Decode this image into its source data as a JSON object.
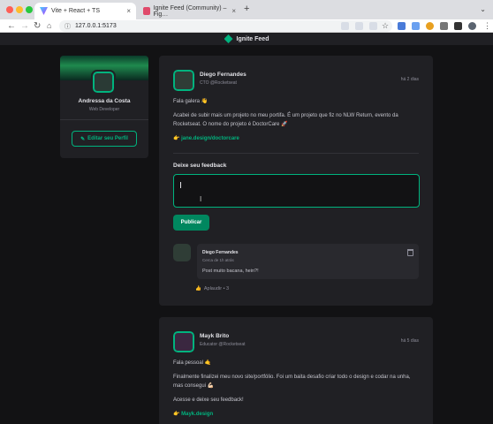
{
  "browser": {
    "tabs": [
      {
        "title": "Vite + React + TS",
        "active": true
      },
      {
        "title": "Ignite Feed (Community) – Fig…",
        "active": false
      }
    ],
    "url": "127.0.0.1:5173",
    "new_tab_icon": "plus-icon"
  },
  "app": {
    "title": "Ignite Feed"
  },
  "profile": {
    "name": "Andressa da Costa",
    "role": "Web Developer",
    "edit_label": "Editar seu Perfil"
  },
  "posts": [
    {
      "author": "Diego Fernandes",
      "role": "CTO @Rocketseat",
      "time": "há 2 dias",
      "greeting": "Fala galera 👋",
      "body": "Acabei de subir mais um projeto no meu portifa. É um projeto que fiz no NLW Return, evento da Rocketseat. O nome do projeto é DoctorCare 🚀",
      "link": "👉 jane.design/doctorcare",
      "feedback_label": "Deixe seu feedback",
      "publish_label": "Publicar",
      "comment": {
        "author": "Diego Fernandes",
        "time": "Cerca de 1h atrás",
        "text": "Post muito bacana, hein?!",
        "applause": "Aplaudir • 3"
      }
    },
    {
      "author": "Mayk Brito",
      "role": "Educator @Rocketseat",
      "time": "há 5 dias",
      "greeting": "Fala pessoal 🤙",
      "body": "Finalmente finalizei meu novo site/portfólio. Foi um baita desafio criar todo o design e codar na unha, mas consegui 💪🏻",
      "cta": "Acesse e deixe seu feedback!",
      "link": "👉 Mayk.design"
    }
  ],
  "colors": {
    "accent": "#00b37e",
    "bg": "#121214",
    "card": "#202024"
  }
}
